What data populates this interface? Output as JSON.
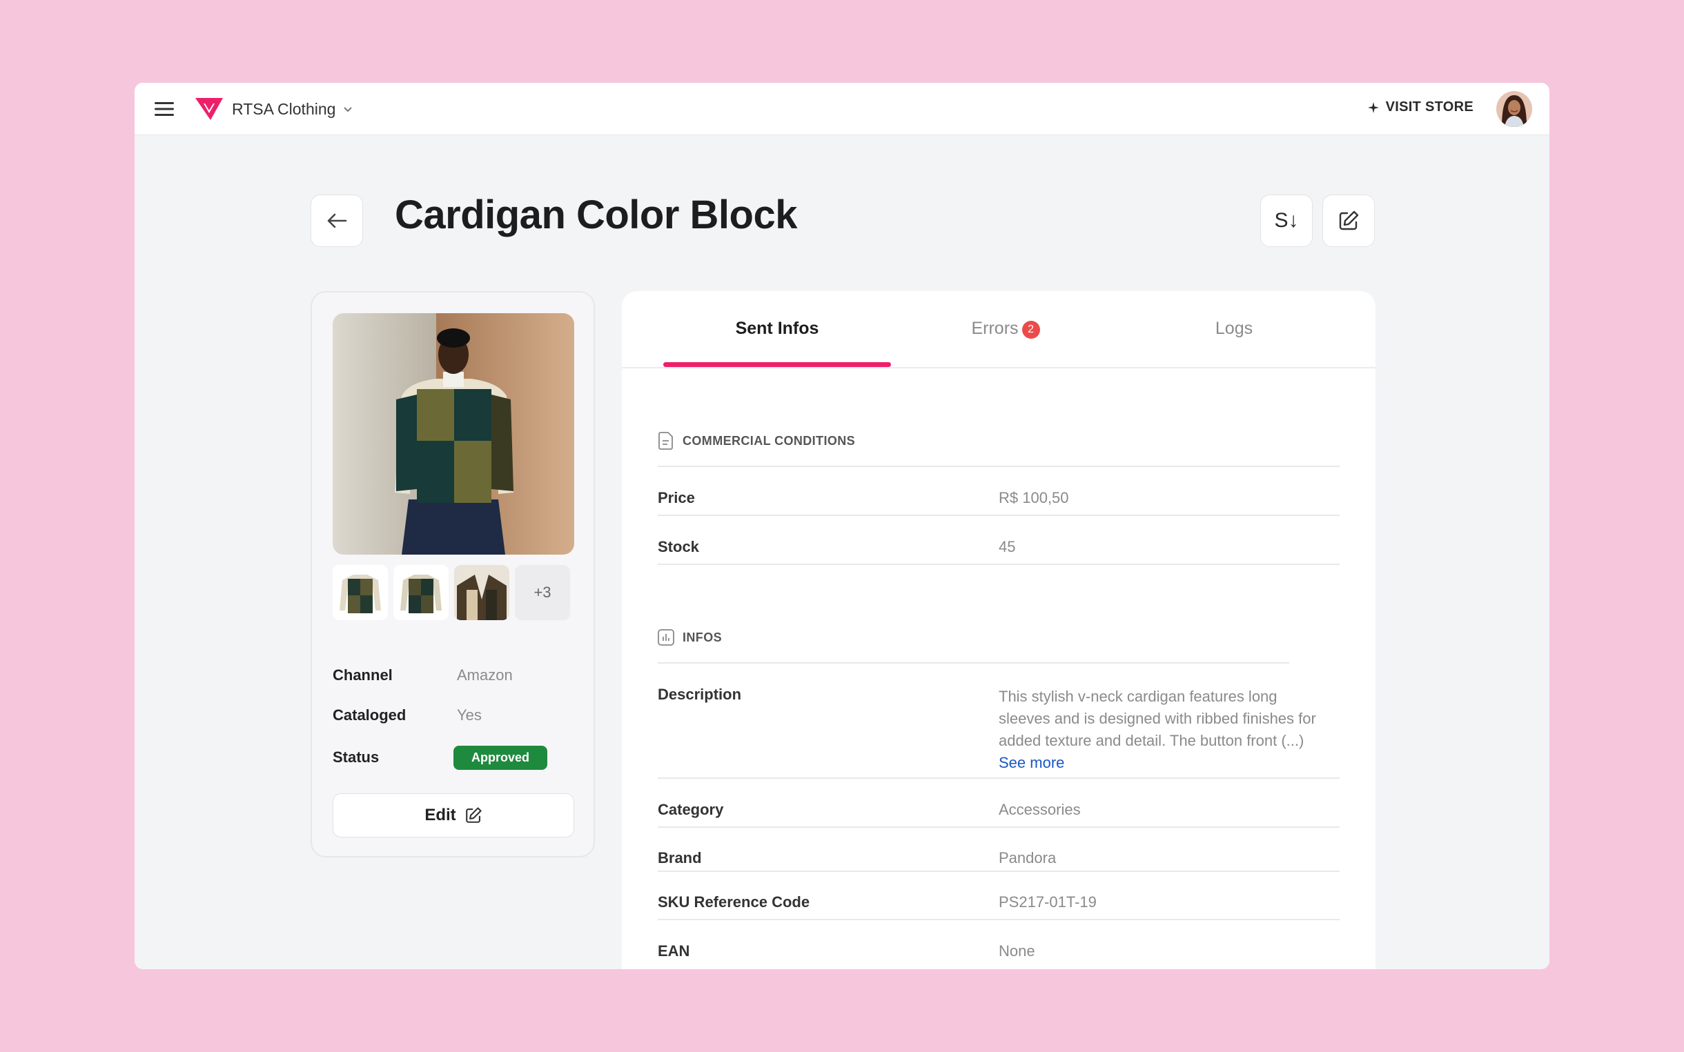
{
  "header": {
    "brand_name": "RTSA Clothing",
    "visit_store_label": "VISIT STORE"
  },
  "page": {
    "title": "Cardigan Color Block",
    "sort_label": "S↓"
  },
  "product": {
    "thumbnails_more": "+3",
    "meta": [
      {
        "label": "Channel",
        "value": "Amazon"
      },
      {
        "label": "Cataloged",
        "value": "Yes"
      },
      {
        "label": "Status",
        "value": "Approved"
      }
    ],
    "edit_label": "Edit"
  },
  "tabs": [
    {
      "label": "Sent Infos",
      "active": true
    },
    {
      "label": "Errors",
      "badge": "2"
    },
    {
      "label": "Logs"
    }
  ],
  "commercial": {
    "heading": "COMMERCIAL CONDITIONS",
    "rows": [
      {
        "label": "Price",
        "value": "R$ 100,50"
      },
      {
        "label": "Stock",
        "value": "45"
      }
    ]
  },
  "infos": {
    "heading": "INFOS",
    "description_label": "Description",
    "description_lines": [
      "This stylish v-neck cardigan features long",
      "sleeves and is designed with ribbed finishes for",
      "added texture and detail. The button front (...)"
    ],
    "see_more": "See more",
    "rows": [
      {
        "label": "Category",
        "value": "Accessories"
      },
      {
        "label": "Brand",
        "value": "Pandora"
      },
      {
        "label": "SKU Reference Code",
        "value": "PS217-01T-19"
      },
      {
        "label": "EAN",
        "value": "None"
      }
    ]
  },
  "colors": {
    "background": "#f6c6dd",
    "accent": "#ee1f6a",
    "status_approved": "#1e8a3e",
    "error_badge": "#ec4a4a",
    "link": "#1a56c4"
  }
}
